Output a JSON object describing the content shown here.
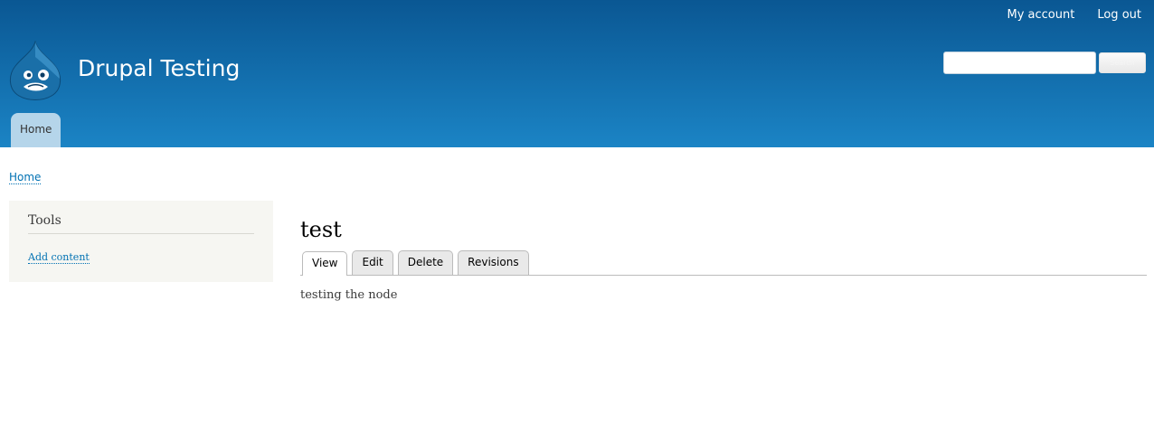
{
  "header": {
    "site_name": "Drupal Testing",
    "secondary_menu": [
      {
        "label": "My account"
      },
      {
        "label": "Log out"
      }
    ],
    "search": {
      "value": "",
      "button_label": "Search"
    },
    "main_menu": [
      {
        "label": "Home"
      }
    ],
    "gradient_top": "#0a5793",
    "gradient_bottom": "#1b84c5"
  },
  "breadcrumb": {
    "items": [
      {
        "label": "Home"
      }
    ]
  },
  "sidebar": {
    "block_title": "Tools",
    "links": [
      {
        "label": "Add content"
      }
    ]
  },
  "content": {
    "title": "test",
    "tabs": [
      {
        "label": "View",
        "active": true
      },
      {
        "label": "Edit",
        "active": false
      },
      {
        "label": "Delete",
        "active": false
      },
      {
        "label": "Revisions",
        "active": false
      }
    ],
    "body": "testing the node"
  },
  "icons": {
    "logo": "drupal-drop-logo"
  },
  "colors": {
    "link": "#0071b3",
    "sidebar_bg": "#f6f6f2",
    "menu_tab_bg": "#b5d5ea"
  }
}
